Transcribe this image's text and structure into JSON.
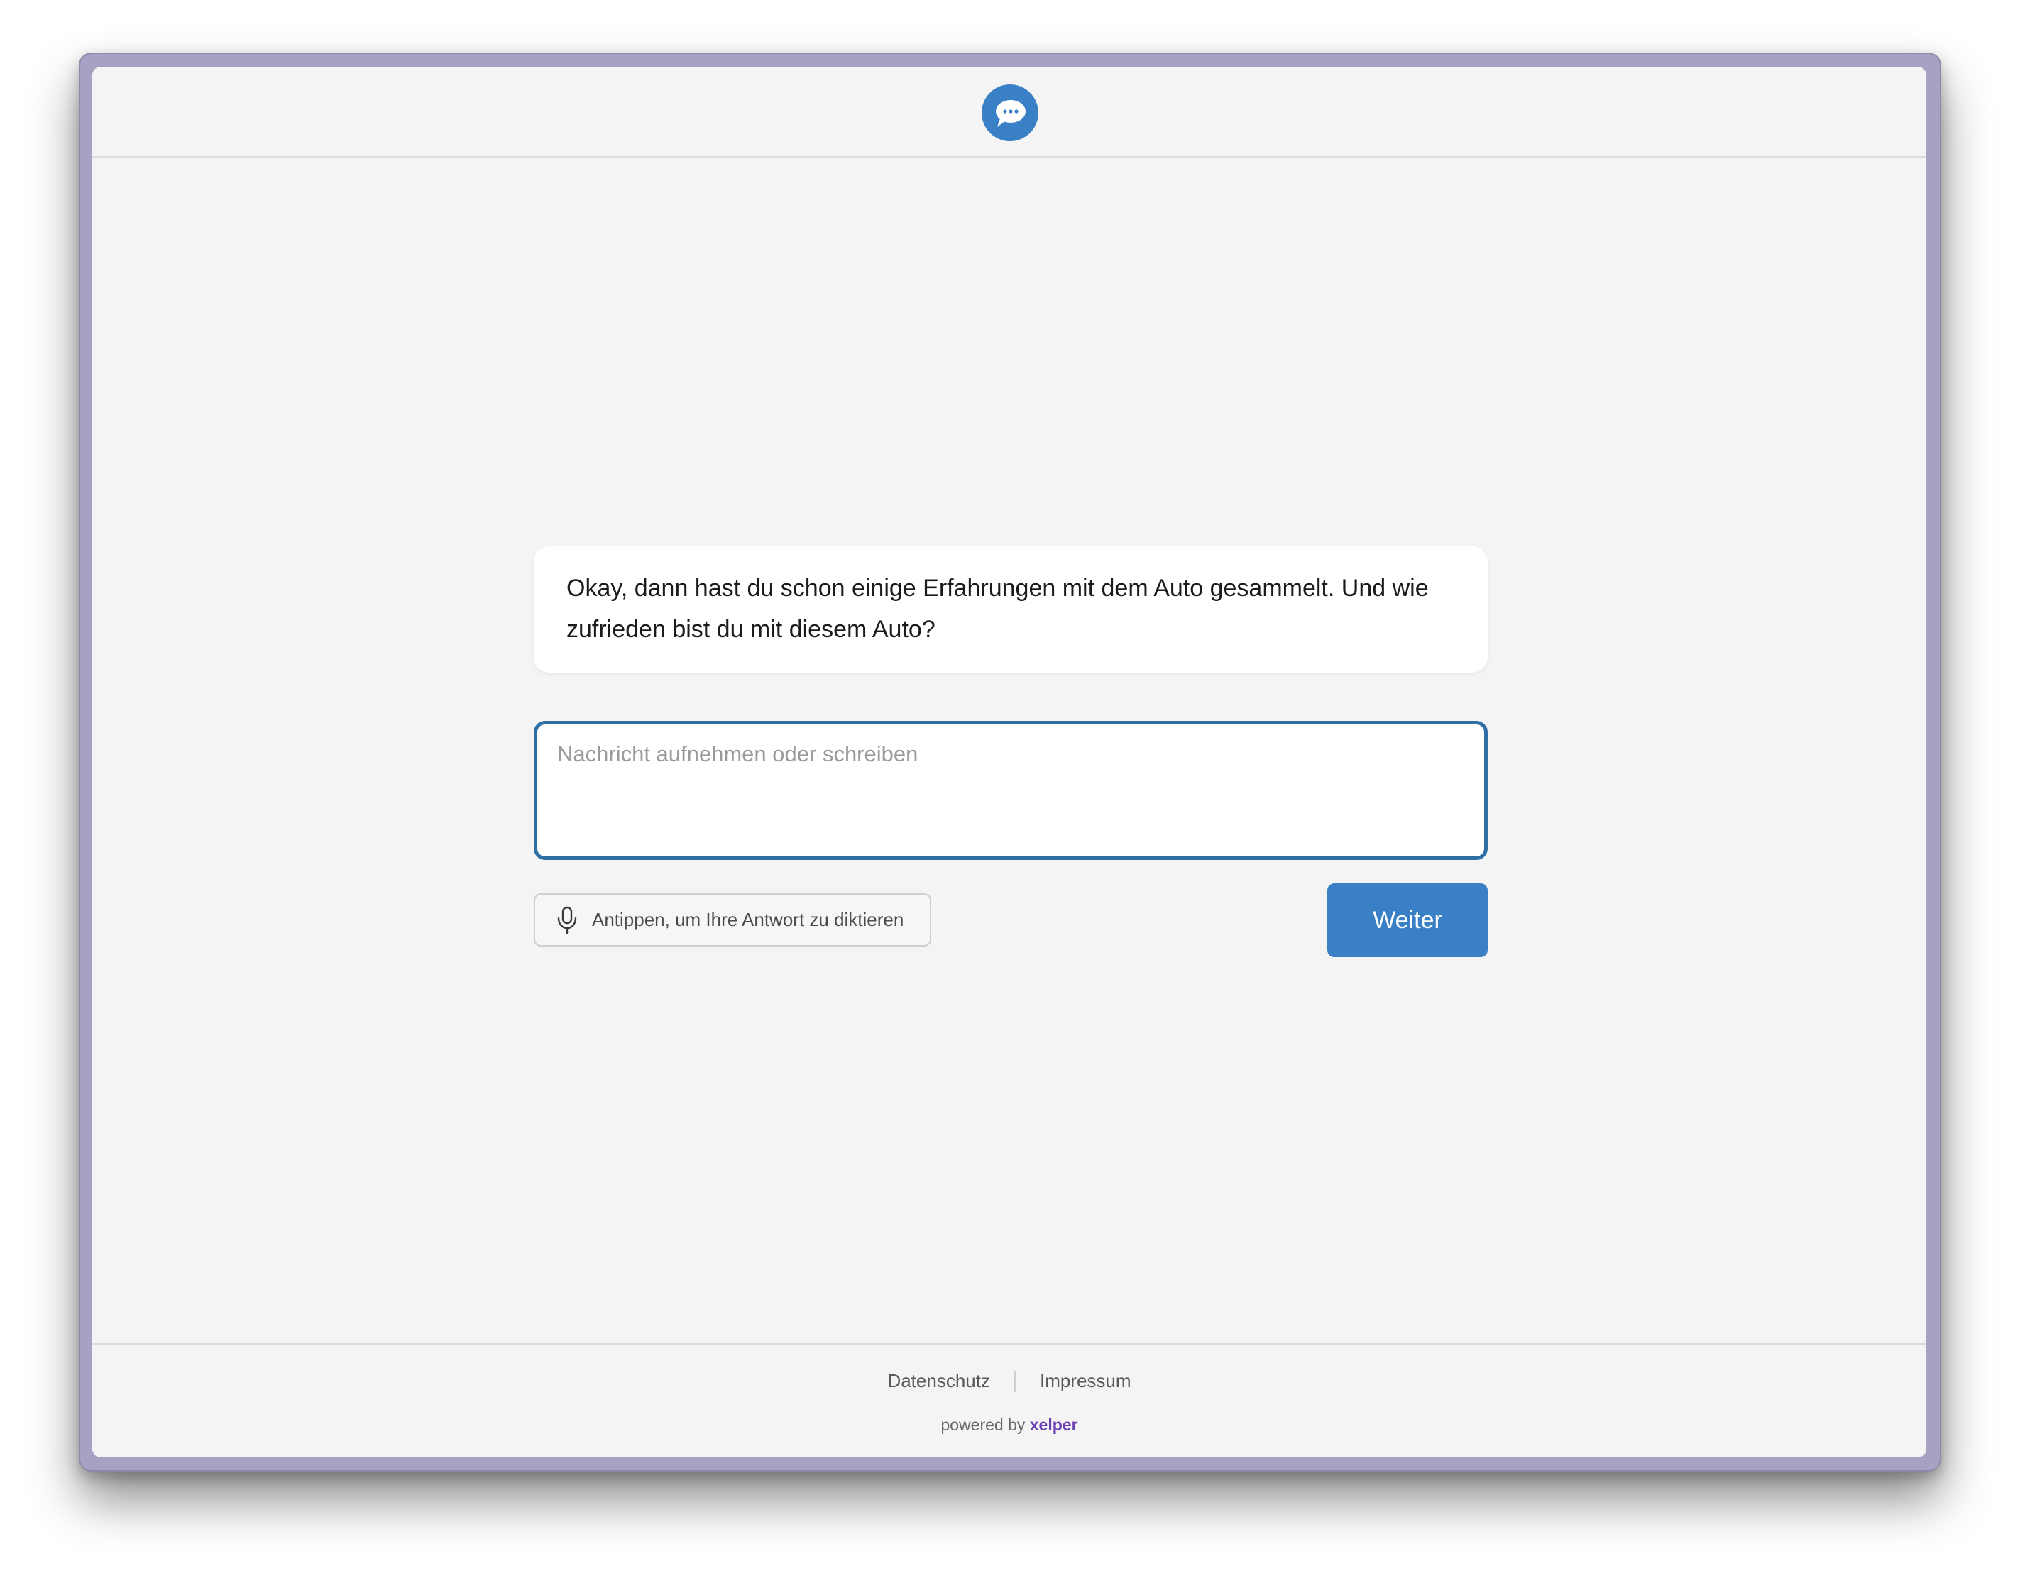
{
  "header": {
    "logo_icon": "chat-bubble-icon",
    "accent_color": "#3a80c6"
  },
  "conversation": {
    "message": "Okay, dann hast du schon einige Erfahrungen mit dem Auto gesammelt. Und wie zufrieden bist du mit diesem Auto?"
  },
  "input": {
    "placeholder": "Nachricht aufnehmen oder schreiben",
    "value": ""
  },
  "dictate": {
    "icon": "microphone-icon",
    "label": "Antippen, um Ihre Antwort zu diktieren"
  },
  "actions": {
    "next_label": "Weiter"
  },
  "footer": {
    "privacy_label": "Datenschutz",
    "imprint_label": "Impressum",
    "powered_prefix": "powered by",
    "brand": "xelper",
    "brand_color": "#6a3fb0"
  }
}
